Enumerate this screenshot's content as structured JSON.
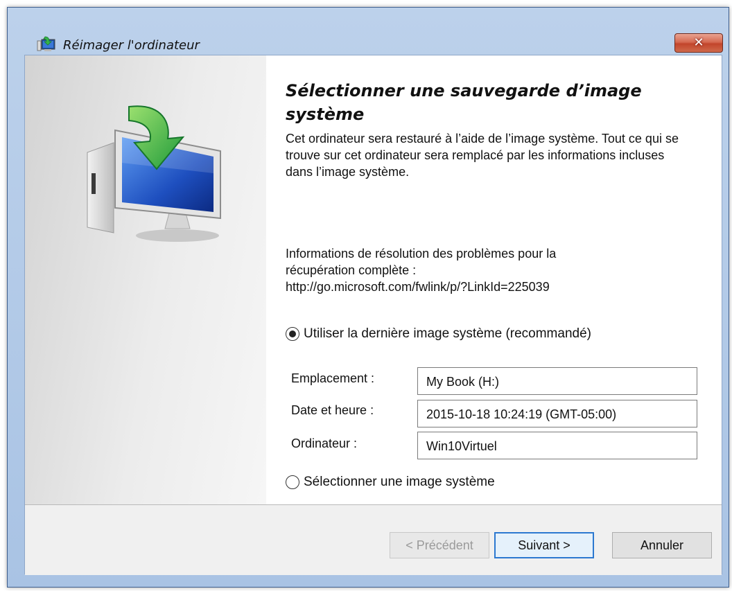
{
  "window": {
    "title": "Réimager l'ordinateur",
    "close_label": "✕"
  },
  "content": {
    "heading": "Sélectionner une sauvegarde d’image système",
    "description": "Cet ordinateur sera restauré à l’aide de l’image système. Tout ce qui se trouve sur cet ordinateur sera remplacé par les informations incluses dans l’image système.",
    "troubleshoot_line1": "Informations de résolution des problèmes pour la",
    "troubleshoot_line2": "récupération complète :",
    "troubleshoot_url": "http://go.microsoft.com/fwlink/p/?LinkId=225039"
  },
  "options": {
    "latest_label": "Utiliser la dernière image système (recommandé)",
    "latest_selected": true,
    "select_label": "Sélectionner une image système",
    "select_selected": false
  },
  "details": {
    "location_label": "Emplacement :",
    "location_value": "My Book (H:)",
    "datetime_label": "Date et heure :",
    "datetime_value": "2015-10-18 10:24:19 (GMT-05:00)",
    "computer_label": "Ordinateur :",
    "computer_value": "Win10Virtuel"
  },
  "buttons": {
    "back": "< Précédent",
    "next": "Suivant >",
    "cancel": "Annuler"
  },
  "icons": {
    "title_icon": "restore-computer-icon",
    "hero": "computer-restore-arrow-icon"
  }
}
